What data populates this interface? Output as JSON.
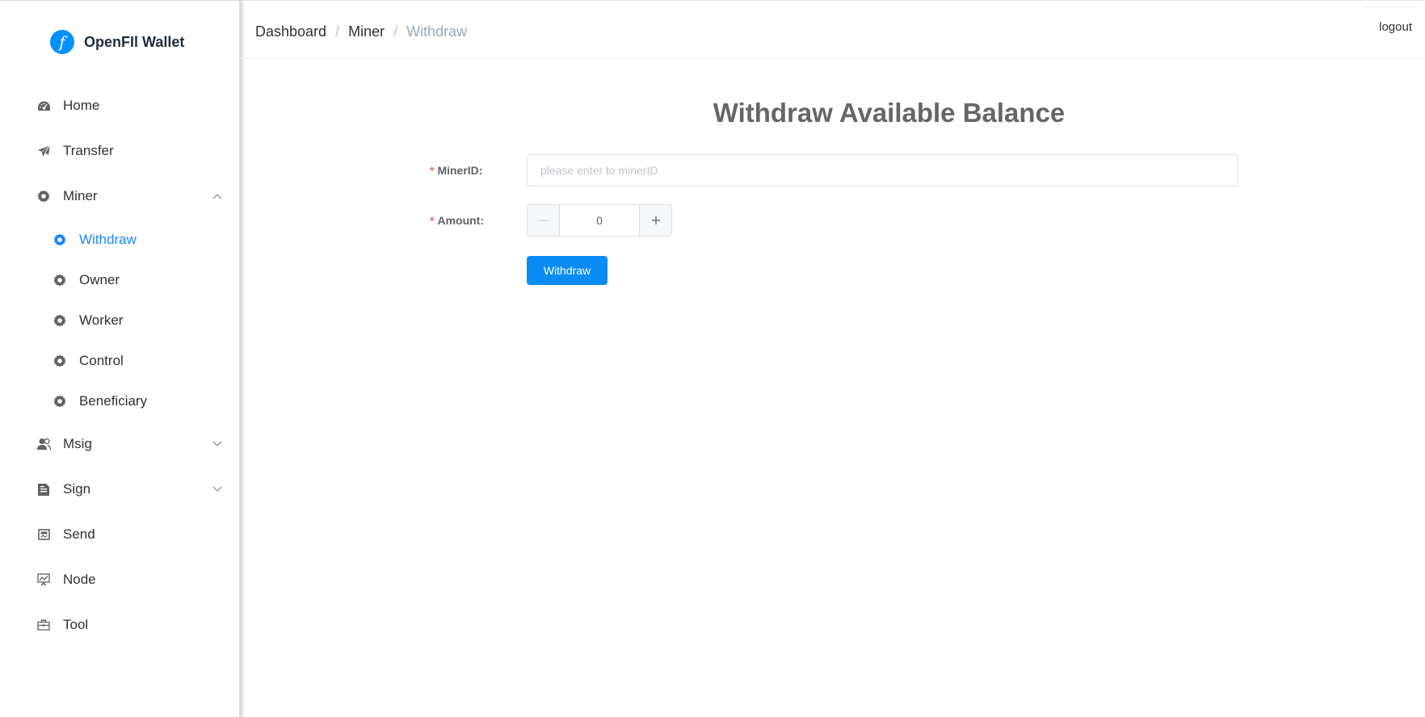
{
  "app": {
    "brand_name": "OpenFIl Wallet",
    "brand_glyph": "f"
  },
  "sidebar": {
    "items": [
      {
        "label": "Home",
        "icon": "dashboard-icon"
      },
      {
        "label": "Transfer",
        "icon": "paper-plane-icon"
      },
      {
        "label": "Miner",
        "icon": "gear-icon",
        "expanded": true,
        "children": [
          {
            "label": "Withdraw",
            "icon": "gear-icon",
            "active": true
          },
          {
            "label": "Owner",
            "icon": "gear-icon"
          },
          {
            "label": "Worker",
            "icon": "gear-icon"
          },
          {
            "label": "Control",
            "icon": "gear-icon"
          },
          {
            "label": "Beneficiary",
            "icon": "gear-icon"
          }
        ]
      },
      {
        "label": "Msig",
        "icon": "users-icon",
        "expanded": false
      },
      {
        "label": "Sign",
        "icon": "document-icon",
        "expanded": false
      },
      {
        "label": "Send",
        "icon": "image-card-icon"
      },
      {
        "label": "Node",
        "icon": "monitor-chart-icon"
      },
      {
        "label": "Tool",
        "icon": "toolbox-icon"
      }
    ]
  },
  "header": {
    "breadcrumb": [
      "Dashboard",
      "Miner",
      "Withdraw"
    ],
    "separator": "/",
    "logout_label": "logout"
  },
  "form": {
    "title": "Withdraw Available Balance",
    "required_mark": "*",
    "miner_label": "MinerID:",
    "miner_value": "",
    "miner_placeholder": "please enter to minerID",
    "amount_label": "Amount:",
    "amount_value": "0",
    "submit_label": "Withdraw"
  },
  "colors": {
    "accent": "#0a8cf5",
    "active_menu": "#1989fa",
    "required": "#f56c6c",
    "title": "#666666"
  }
}
